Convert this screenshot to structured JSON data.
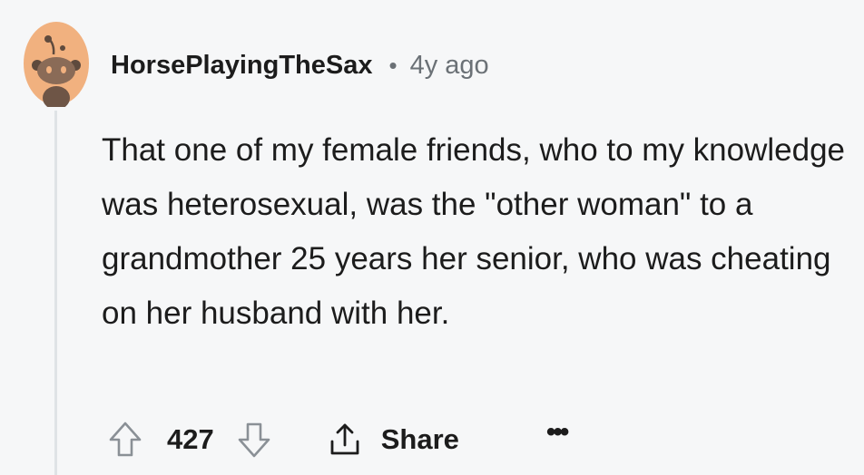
{
  "comment": {
    "username": "HorsePlayingTheSax",
    "separator": "•",
    "time": "4y ago",
    "body": "That one of my female friends, who to my knowledge was heterosexual, was the \"other woman\" to a grandmother 25 years her senior, who was cheating on her husband with her."
  },
  "actions": {
    "score": "427",
    "share_label": "Share",
    "more_label": "•••"
  },
  "icons": {
    "avatar": "default-snoo-avatar",
    "upvote": "upvote-arrow-icon",
    "downvote": "downvote-arrow-icon",
    "share": "share-icon",
    "more": "more-options-icon"
  },
  "colors": {
    "background": "#f6f7f8",
    "avatar_background": "#f1b17f",
    "text": "#1c1c1c",
    "muted": "#6b7176",
    "thread_line": "#dfe3e6"
  }
}
